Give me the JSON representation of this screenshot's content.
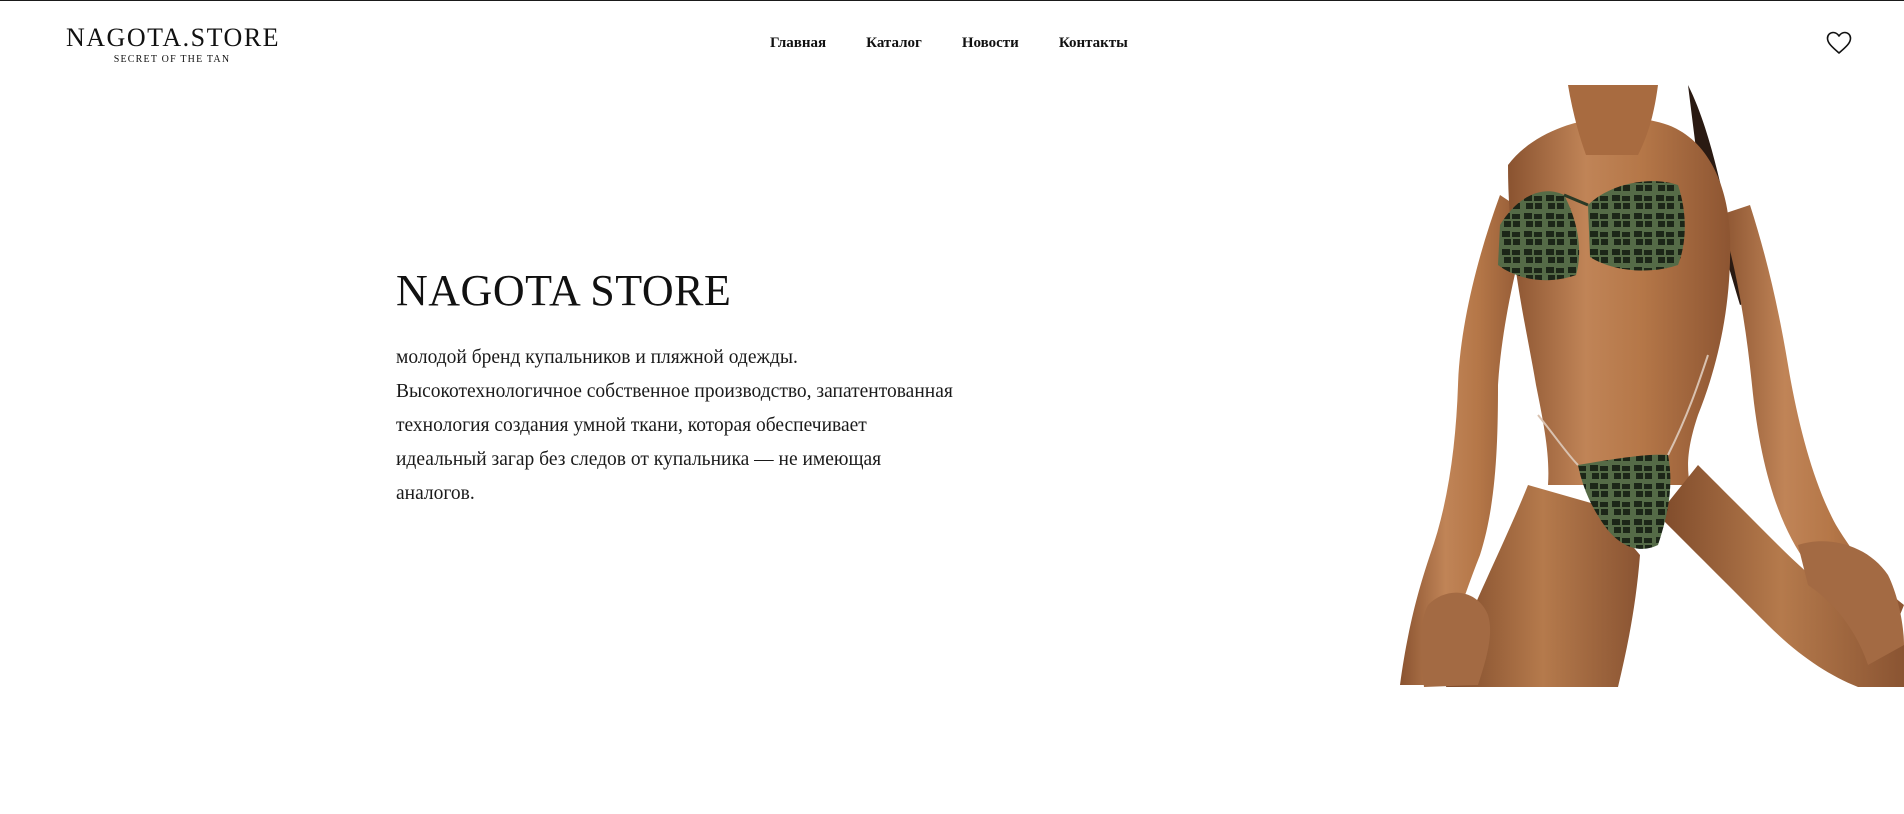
{
  "header": {
    "logo": {
      "main": "NAGOTA.STORE",
      "sub": "SECRET OF THE TAN"
    },
    "nav": [
      {
        "label": "Главная"
      },
      {
        "label": "Каталог"
      },
      {
        "label": "Новости"
      },
      {
        "label": "Контакты"
      }
    ],
    "favorites_icon": "heart-icon"
  },
  "hero": {
    "title": "NAGOTA STORE",
    "text": "молодой бренд купальников и пляжной одежды. Высокотехнологичное собственное производство, запатентованная технология создания умной ткани, которая обеспечивает идеальный загар без следов от купальника — не имеющая аналогов."
  },
  "colors": {
    "text": "#111111",
    "background": "#ffffff",
    "skin": "#b8784a",
    "swimwear": "#2b3a26"
  }
}
